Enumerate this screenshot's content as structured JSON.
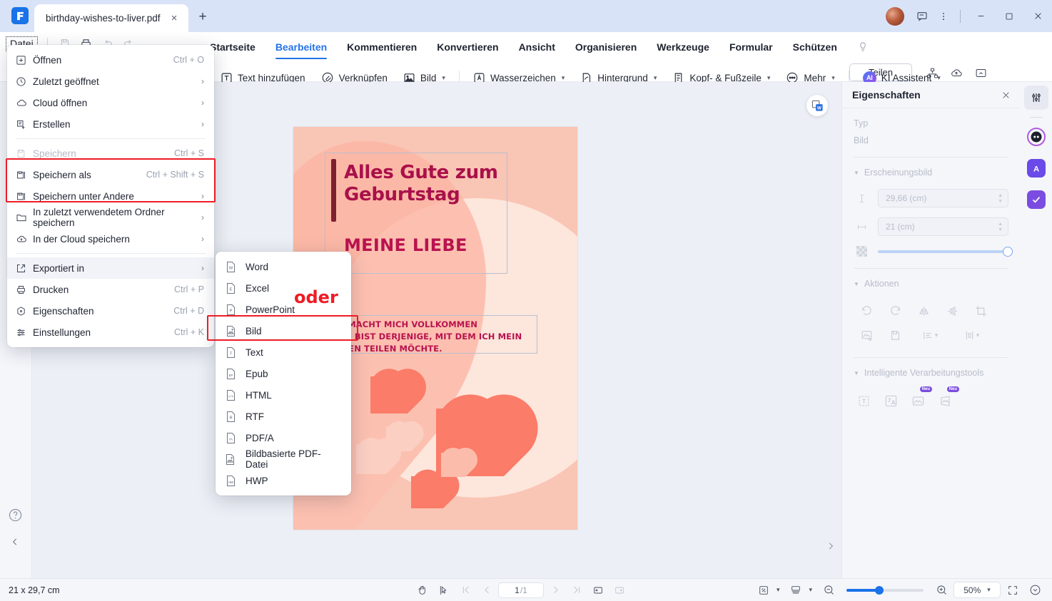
{
  "window": {
    "tab_title": "birthday-wishes-to-liver.pdf",
    "new_tab_label": "+",
    "close_tab_label": "×",
    "minimize_label": "—",
    "maximize_label": "□",
    "close_label": "✕"
  },
  "quickaccess": {
    "file_button": "Datei",
    "icons": [
      "save-icon",
      "print-icon",
      "undo-icon",
      "redo-icon"
    ]
  },
  "ribbon": {
    "tabs": [
      {
        "label": "Startseite",
        "active": false
      },
      {
        "label": "Bearbeiten",
        "active": true
      },
      {
        "label": "Kommentieren",
        "active": false
      },
      {
        "label": "Konvertieren",
        "active": false
      },
      {
        "label": "Ansicht",
        "active": false
      },
      {
        "label": "Organisieren",
        "active": false
      },
      {
        "label": "Werkzeuge",
        "active": false
      },
      {
        "label": "Formular",
        "active": false
      },
      {
        "label": "Schützen",
        "active": false
      }
    ],
    "share_label": "Teilen",
    "tools": [
      {
        "label": "Text hinzufügen",
        "icon": "text-box-icon",
        "caret": false
      },
      {
        "label": "Verknüpfen",
        "icon": "link-icon",
        "caret": false
      },
      {
        "label": "Bild",
        "icon": "image-icon",
        "caret": true
      },
      {
        "label": "Wasserzeichen",
        "icon": "watermark-icon",
        "caret": true
      },
      {
        "label": "Hintergrund",
        "icon": "background-icon",
        "caret": true
      },
      {
        "label": "Kopf- & Fußzeile",
        "icon": "header-footer-icon",
        "caret": true
      },
      {
        "label": "Mehr",
        "icon": "more-dots-icon",
        "caret": true
      }
    ],
    "ai_assistant": {
      "label": "KI Assistent",
      "badge": "AI",
      "caret": true
    }
  },
  "filemenu": {
    "items": [
      {
        "label": "Öffnen",
        "shortcut": "Ctrl + O",
        "arrow": false,
        "icon": "plus-box-icon",
        "disabled": false,
        "hover": false
      },
      {
        "label": "Zuletzt geöffnet",
        "shortcut": "",
        "arrow": true,
        "icon": "clock-icon",
        "disabled": false,
        "hover": false
      },
      {
        "label": "Cloud öffnen",
        "shortcut": "",
        "arrow": true,
        "icon": "cloud-icon",
        "disabled": false,
        "hover": false
      },
      {
        "label": "Erstellen",
        "shortcut": "",
        "arrow": true,
        "icon": "create-doc-icon",
        "disabled": false,
        "hover": false
      },
      {
        "label": "Speichern",
        "shortcut": "Ctrl + S",
        "arrow": false,
        "icon": "floppy-icon",
        "disabled": true,
        "hover": false
      },
      {
        "label": "Speichern als",
        "shortcut": "Ctrl + Shift + S",
        "arrow": false,
        "icon": "save-as-icon",
        "disabled": false,
        "hover": false
      },
      {
        "label": "Speichern unter Andere",
        "shortcut": "",
        "arrow": true,
        "icon": "save-other-icon",
        "disabled": false,
        "hover": false
      },
      {
        "label": "In zuletzt verwendetem Ordner speichern",
        "shortcut": "",
        "arrow": true,
        "icon": "folder-icon",
        "disabled": false,
        "hover": false
      },
      {
        "label": "In der Cloud speichern",
        "shortcut": "",
        "arrow": true,
        "icon": "cloud-upload-icon",
        "disabled": false,
        "hover": false
      },
      {
        "label": "Exportiert in",
        "shortcut": "",
        "arrow": true,
        "icon": "export-icon",
        "disabled": false,
        "hover": true
      },
      {
        "label": "Drucken",
        "shortcut": "Ctrl + P",
        "arrow": false,
        "icon": "printer-icon",
        "disabled": false,
        "hover": false
      },
      {
        "label": "Eigenschaften",
        "shortcut": "Ctrl + D",
        "arrow": false,
        "icon": "properties-icon",
        "disabled": false,
        "hover": false
      },
      {
        "label": "Einstellungen",
        "shortcut": "Ctrl + K",
        "arrow": false,
        "icon": "settings-sliders-icon",
        "disabled": false,
        "hover": false
      }
    ],
    "highlight_color": "#ee1c25"
  },
  "exportmenu": {
    "items": [
      {
        "label": "Word",
        "icon": "word-file-icon",
        "glyph": "W"
      },
      {
        "label": "Excel",
        "icon": "excel-file-icon",
        "glyph": "E"
      },
      {
        "label": "PowerPoint",
        "icon": "powerpoint-file-icon",
        "glyph": "P"
      },
      {
        "label": "Bild",
        "icon": "image-file-icon",
        "glyph": ""
      },
      {
        "label": "Text",
        "icon": "text-file-icon",
        "glyph": "T"
      },
      {
        "label": "Epub",
        "icon": "epub-file-icon",
        "glyph": "EP"
      },
      {
        "label": "HTML",
        "icon": "html-file-icon",
        "glyph": "</>"
      },
      {
        "label": "RTF",
        "icon": "rtf-file-icon",
        "glyph": "R"
      },
      {
        "label": "PDF/A",
        "icon": "pdfa-file-icon",
        "glyph": "/A"
      },
      {
        "label": "Bildbasierte PDF-Datei",
        "icon": "image-pdf-file-icon",
        "glyph": ""
      },
      {
        "label": "HWP",
        "icon": "hwp-file-icon",
        "glyph": "HW"
      }
    ]
  },
  "annotation": {
    "oder_label": "oder"
  },
  "document": {
    "title_line1": "Alles Gute zum",
    "title_line2": "Geburtstag",
    "subtitle": "MEINE LIEBE",
    "body_line1": "DU MACHT MICH VOLLKOMMEN",
    "body_line2": "UND BIST DERJENIGE, MIT DEM ICH MEIN",
    "body_line3": "LEBEN TEILEN MÖCHTE."
  },
  "properties": {
    "panel_title": "Eigenschaften",
    "type_label": "Typ",
    "type_value": "Bild",
    "appearance_label": "Erscheinungsbild",
    "height_value": "29,66 (cm)",
    "width_value": "21 (cm)",
    "actions_label": "Aktionen",
    "smart_tools_label": "Intelligente Verarbeitungstools",
    "new_badge": "Neu"
  },
  "statusbar": {
    "page_size": "21 x 29,7 cm",
    "current_page": "1",
    "total_pages": "/1",
    "zoom_level": "50%"
  }
}
